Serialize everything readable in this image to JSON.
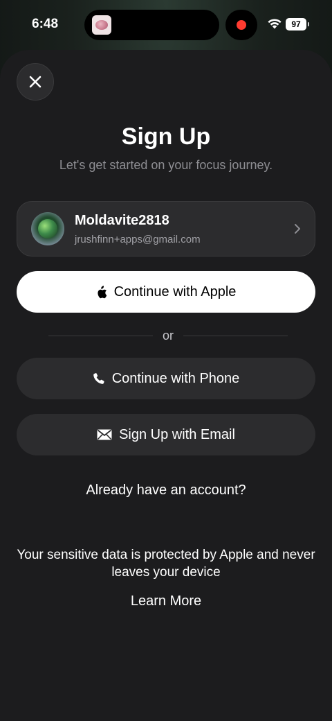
{
  "status_bar": {
    "time": "6:48",
    "battery": "97"
  },
  "sheet": {
    "title": "Sign Up",
    "subtitle": "Let's get started on your focus journey.",
    "account": {
      "name": "Moldavite2818",
      "email": "jrushfinn+apps@gmail.com"
    },
    "buttons": {
      "apple": "Continue with Apple",
      "or": "or",
      "phone": "Continue with Phone",
      "email": "Sign Up with Email"
    },
    "existing_account": "Already have an account?",
    "privacy": "Your sensitive data is protected by Apple and never leaves your device",
    "learn_more": "Learn More"
  },
  "icons": {
    "close": "close-icon",
    "apple": "apple-logo-icon",
    "phone": "phone-icon",
    "email": "envelope-icon",
    "chevron": "chevron-right-icon"
  },
  "colors": {
    "sheet_bg": "#1c1c1e",
    "button_dark": "#2c2c2e",
    "button_light": "#ffffff",
    "record": "#ff3b30"
  }
}
